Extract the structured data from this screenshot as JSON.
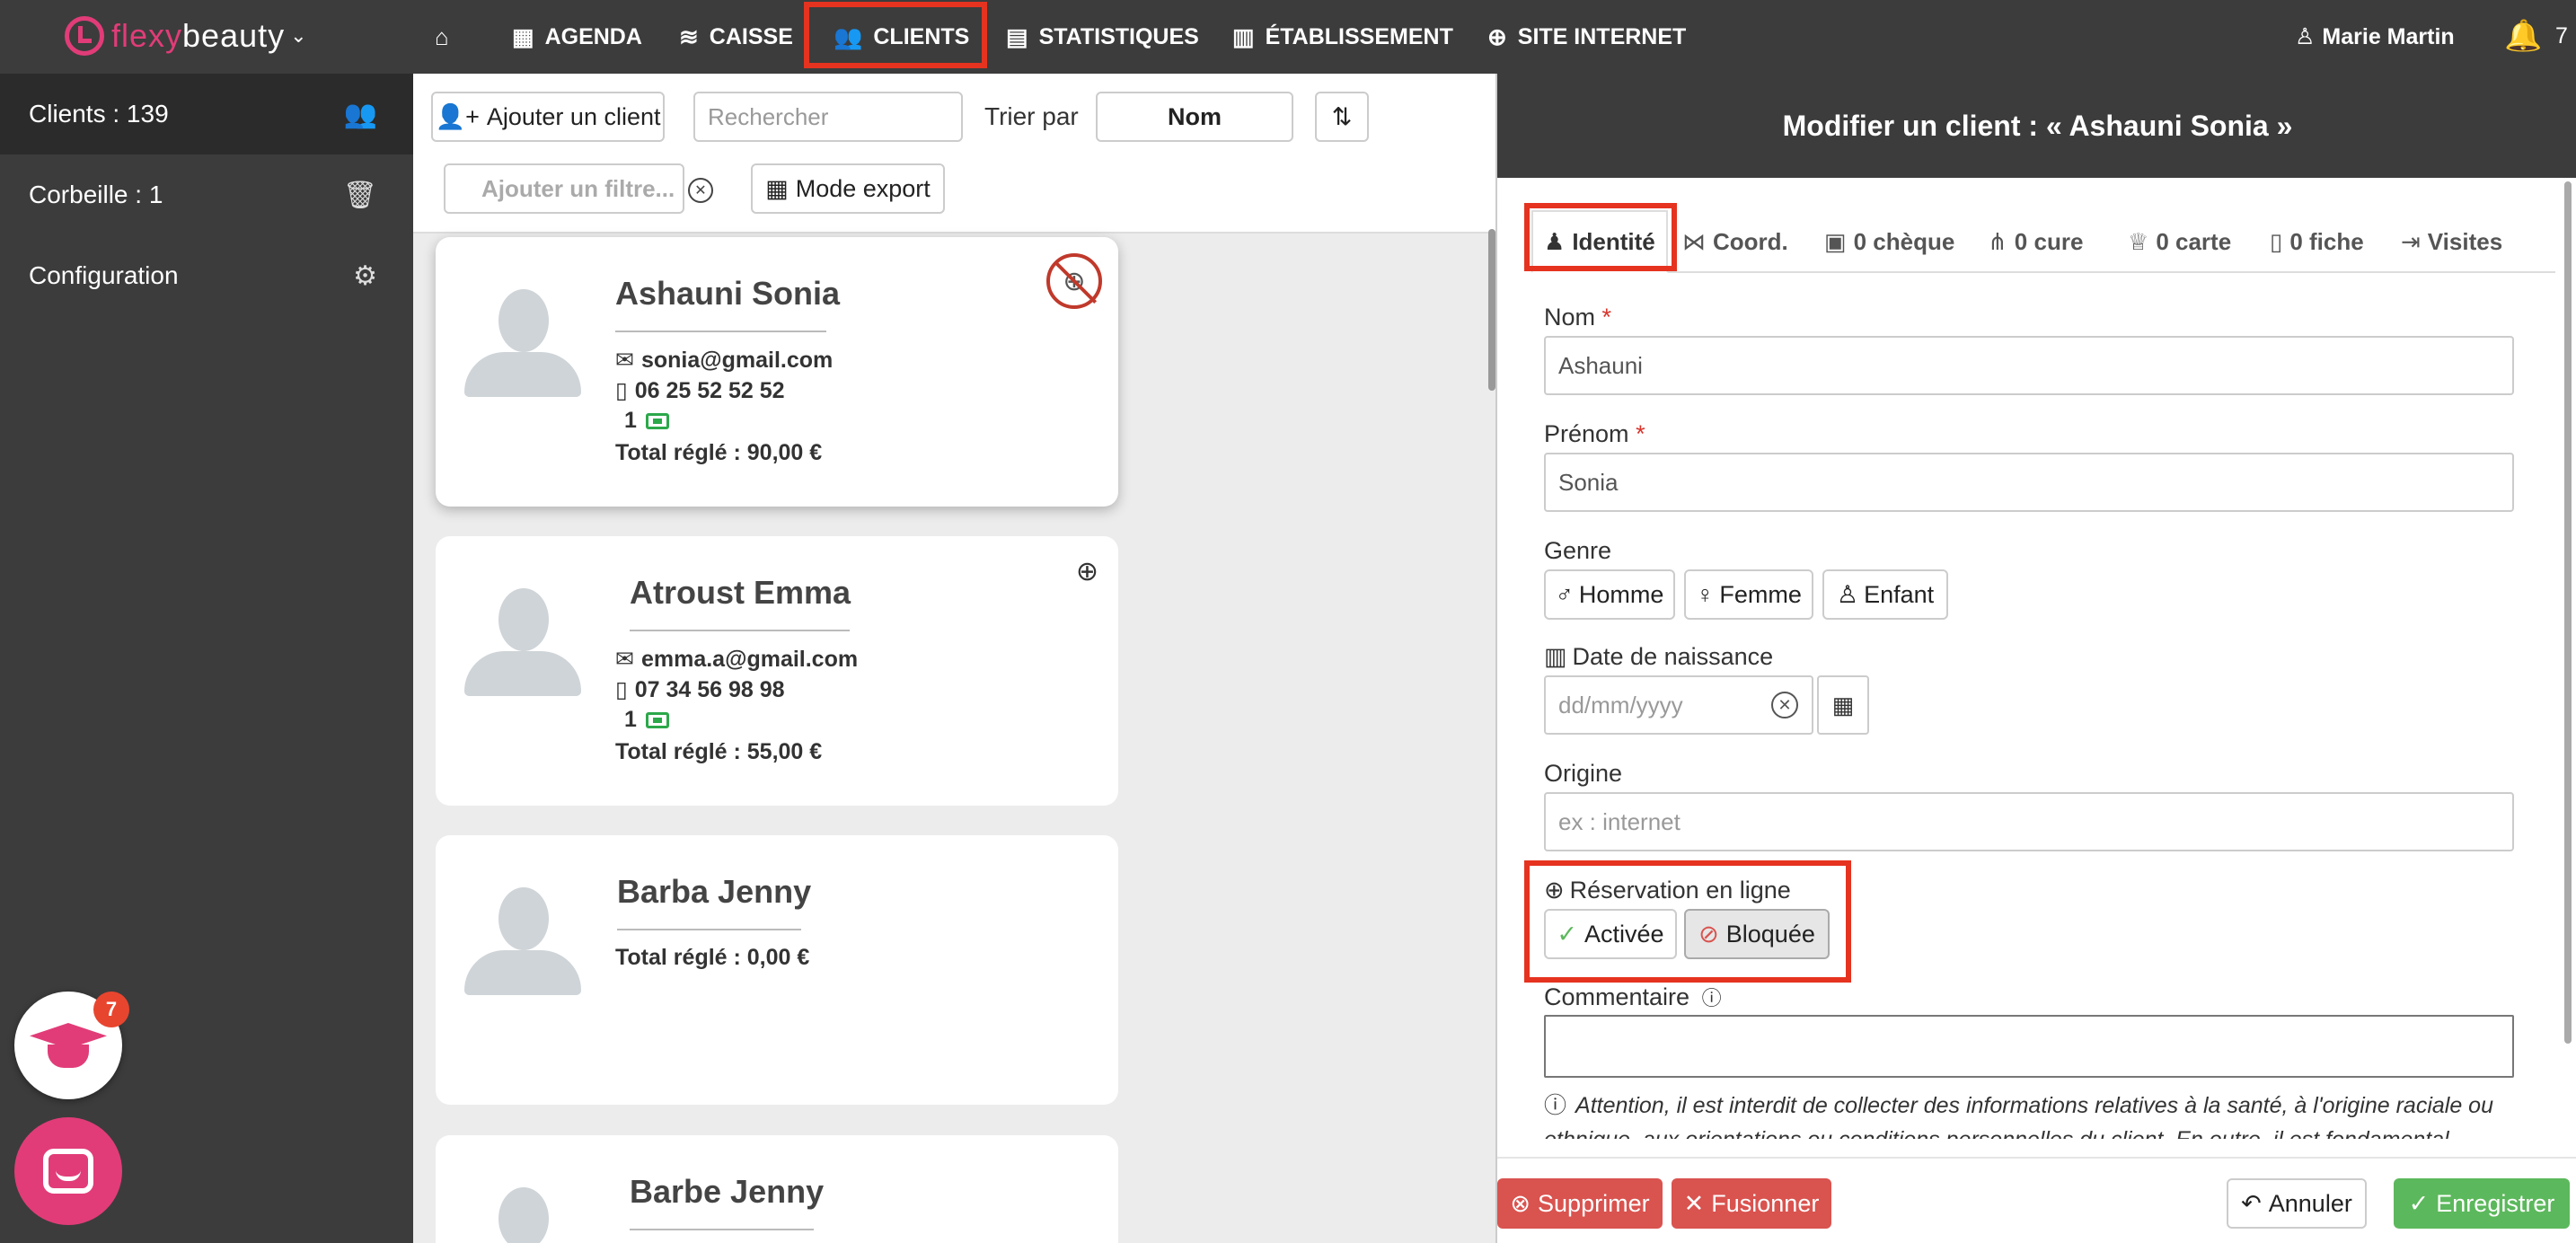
{
  "colors": {
    "brand": "#e13c78",
    "nav_bg": "#3c3c3c",
    "highlight": "#e53320",
    "danger": "#d9534f",
    "success": "#5cb85c"
  },
  "nav": {
    "logo_text_1": "flexy",
    "logo_text_2": "beauty",
    "items": [
      {
        "label": "",
        "icon": "home-icon"
      },
      {
        "label": "AGENDA",
        "icon": "calendar-icon"
      },
      {
        "label": "CAISSE",
        "icon": "coins-icon"
      },
      {
        "label": "CLIENTS",
        "icon": "users-icon"
      },
      {
        "label": "STATISTIQUES",
        "icon": "chart-icon"
      },
      {
        "label": "ÉTABLISSEMENT",
        "icon": "store-icon"
      },
      {
        "label": "SITE INTERNET",
        "icon": "globe-icon"
      }
    ],
    "user": "Marie Martin",
    "notif_count": "7"
  },
  "sidebar": {
    "items": [
      {
        "label": "Clients : 139",
        "icon": "users-icon"
      },
      {
        "label": "Corbeille : 1",
        "icon": "trash-icon"
      },
      {
        "label": "Configuration",
        "icon": "gears-icon"
      }
    ],
    "grad_badge": "7"
  },
  "toolbar": {
    "add_label": "Ajouter un client",
    "search_placeholder": "Rechercher",
    "sort_label": "Trier par",
    "sort_value": "Nom",
    "filter_placeholder": "Ajouter un filtre...",
    "export_label": "Mode export"
  },
  "clients": [
    {
      "name": "Ashauni Sonia",
      "email": "sonia@gmail.com",
      "phone": "06 25 52 52 52",
      "tickets": "1",
      "total": "Total réglé : 90,00 €",
      "online": "blocked"
    },
    {
      "name": "Atroust Emma",
      "email": "emma.a@gmail.com",
      "phone": "07 34 56 98 98",
      "tickets": "1",
      "total": "Total réglé : 55,00 €",
      "online": "enabled"
    },
    {
      "name": "Barba Jenny",
      "total": "Total réglé : 0,00 €"
    },
    {
      "name": "Barbe Jenny"
    }
  ],
  "panel": {
    "title": "Modifier un client : « Ashauni Sonia »",
    "tabs": [
      "Identité",
      "Coord.",
      "0 chèque",
      "0 cure",
      "0 carte",
      "0 fiche",
      "Visites"
    ],
    "nom_label": "Nom",
    "nom_value": "Ashauni",
    "prenom_label": "Prénom",
    "prenom_value": "Sonia",
    "genre_label": "Genre",
    "genre_options": [
      "Homme",
      "Femme",
      "Enfant"
    ],
    "dob_label": "Date de naissance",
    "dob_placeholder": "dd/mm/yyyy",
    "origine_label": "Origine",
    "origine_placeholder": "ex : internet",
    "reservation_label": "Réservation en ligne",
    "reservation_on": "Activée",
    "reservation_off": "Bloquée",
    "reservation_state": "Bloquée",
    "comment_label": "Commentaire",
    "note": "Attention, il est interdit de collecter des informations relatives à la santé, à l'origine raciale ou ethnique, aux orientations ou conditions personnelles du client. En outre, il est fondamental",
    "required_mark": "*"
  },
  "footer": {
    "delete": "Supprimer",
    "merge": "Fusionner",
    "cancel": "Annuler",
    "save": "Enregistrer"
  }
}
